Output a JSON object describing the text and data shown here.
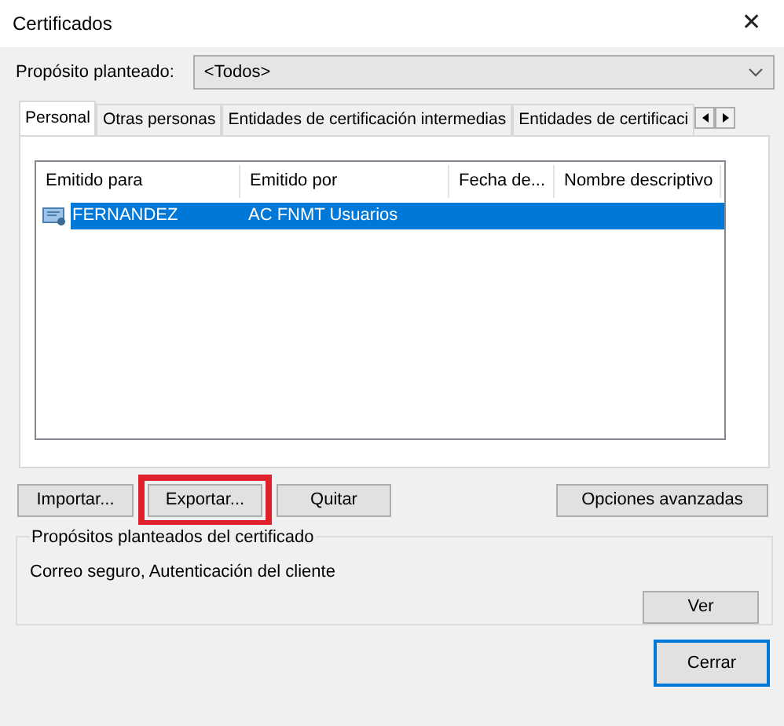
{
  "window": {
    "title": "Certificados",
    "close": "✕"
  },
  "purpose": {
    "label": "Propósito planteado:",
    "value": "<Todos>"
  },
  "tabs": [
    {
      "label": "Personal",
      "selected": true
    },
    {
      "label": "Otras personas",
      "selected": false
    },
    {
      "label": "Entidades de certificación intermedias",
      "selected": false
    },
    {
      "label": "Entidades de certificaci",
      "selected": false
    }
  ],
  "table": {
    "columns": [
      "Emitido para",
      "Emitido por",
      "Fecha de...",
      "Nombre descriptivo"
    ],
    "rows": [
      {
        "cells": [
          "FERNANDEZ",
          "AC FNMT Usuarios"
        ],
        "selected": true
      }
    ]
  },
  "buttons": [
    {
      "label": "Importar...",
      "highlighted": false
    },
    {
      "label": "Exportar...",
      "highlighted": true
    },
    {
      "label": "Quitar",
      "highlighted": false
    }
  ],
  "advanced_button": "Opciones avanzadas",
  "purposes_group": {
    "title": "Propósitos planteados del certificado",
    "text": "Correo seguro, Autenticación del cliente",
    "button": "Ver"
  },
  "close_button": "Cerrar"
}
